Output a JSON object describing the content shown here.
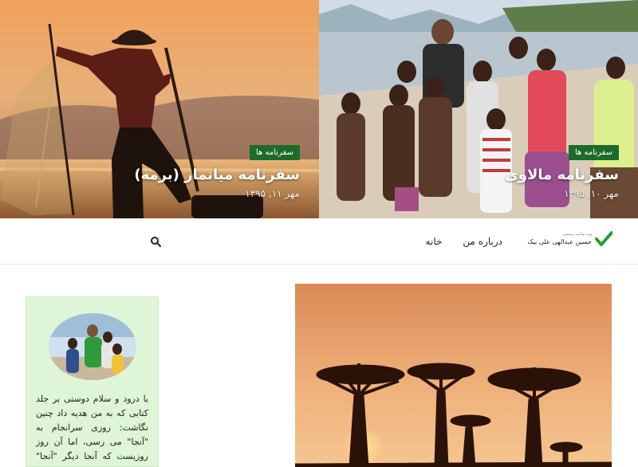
{
  "slides": [
    {
      "category": "سفرنامه ها",
      "title": "سفرنامه میانمار (برمه)",
      "date": "مهر ۱۱, ۱۳۹۵"
    },
    {
      "category": "سفرنامه ها",
      "title": "سفرنامه مالاوی",
      "date": "مهر ۱۰, ۱۳۹۵"
    }
  ],
  "header": {
    "logo_tagline": "وب سایت رسمی",
    "logo_name": "حسین عبدالهی علی بیک",
    "nav": [
      "خانه",
      "درباره من"
    ]
  },
  "sidebar": {
    "about_text": "با درود و سلام دوستی بر جلد کتابی که به من هدیه داد چنین نگاشت: روزی سرانجام به \"آنجا\" می رسی، اما آن روز روزیست که آنجا دیگر \"آنجا\" که می خواستی"
  },
  "colors": {
    "accent": "#1d6b2a",
    "logo_green": "#2e9b3a",
    "widget_bg": "#dff5d8"
  }
}
